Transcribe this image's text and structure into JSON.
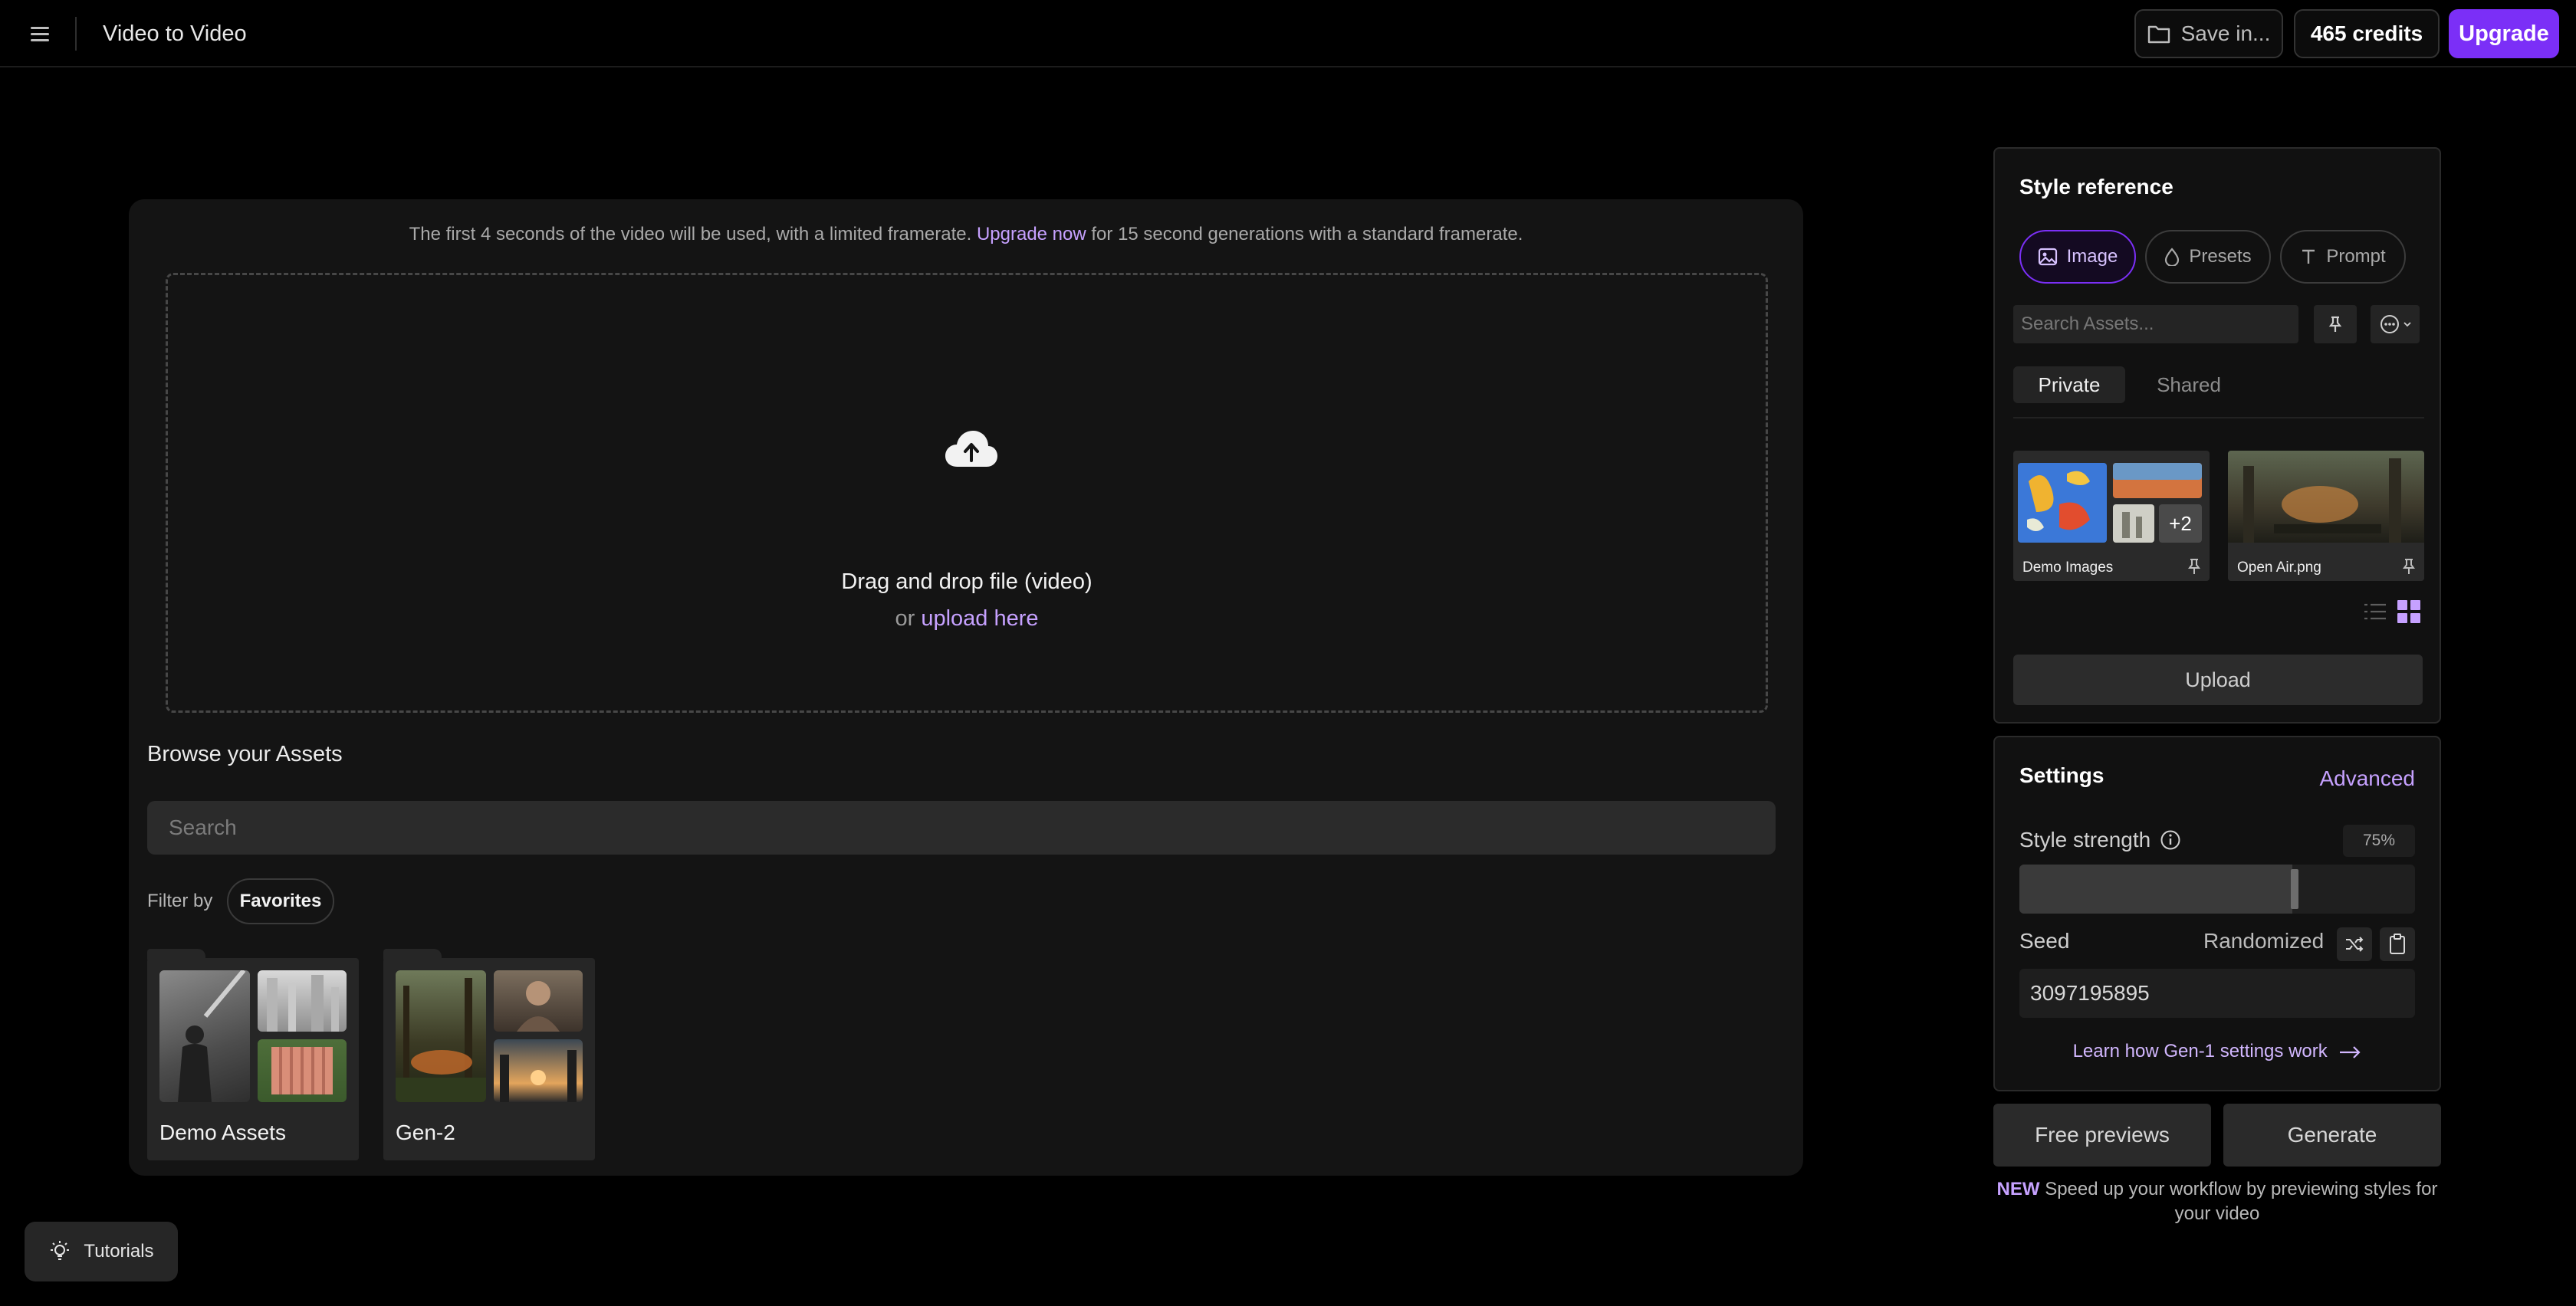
{
  "header": {
    "title": "Video to Video",
    "save_label": "Save in...",
    "credits": "465 credits",
    "upgrade_label": "Upgrade"
  },
  "upload": {
    "notice_prefix": "The first 4 seconds of the video will be used, with a limited framerate.",
    "notice_link": "Upgrade now",
    "notice_suffix": "for 15 second generations with a standard framerate.",
    "drop_title": "Drag and drop file (video)",
    "drop_or": "or",
    "drop_link": "upload here"
  },
  "assets": {
    "title": "Browse your Assets",
    "search_placeholder": "Search",
    "filter_label": "Filter by",
    "filter_chip": "Favorites",
    "folders": [
      {
        "name": "Demo Assets"
      },
      {
        "name": "Gen-2"
      }
    ]
  },
  "style_reference": {
    "title": "Style reference",
    "tabs": [
      {
        "label": "Image",
        "icon": "image-icon",
        "active": true
      },
      {
        "label": "Presets",
        "icon": "drop-icon",
        "active": false
      },
      {
        "label": "Prompt",
        "icon": "text-icon",
        "active": false
      }
    ],
    "search_placeholder": "Search Assets...",
    "segments": [
      "Private",
      "Shared"
    ],
    "cards": [
      {
        "label": "Demo Images",
        "badge": "+2"
      },
      {
        "label": "Open Air.png"
      }
    ],
    "upload_label": "Upload"
  },
  "settings": {
    "title": "Settings",
    "advanced_label": "Advanced",
    "style_strength_label": "Style strength",
    "style_strength_value": "75%",
    "style_strength_fraction": 0.75,
    "seed_label": "Seed",
    "randomized_label": "Randomized",
    "seed_value": "3097195895",
    "learn_link": "Learn how Gen-1 settings work"
  },
  "actions": {
    "free_previews": "Free previews",
    "generate": "Generate",
    "new_badge": "NEW",
    "new_text": "Speed up your workflow by previewing styles for your video"
  },
  "tutorials_label": "Tutorials",
  "colors": {
    "accent": "#7b2ff7",
    "link": "#c6a1ff",
    "panel": "#141414"
  }
}
